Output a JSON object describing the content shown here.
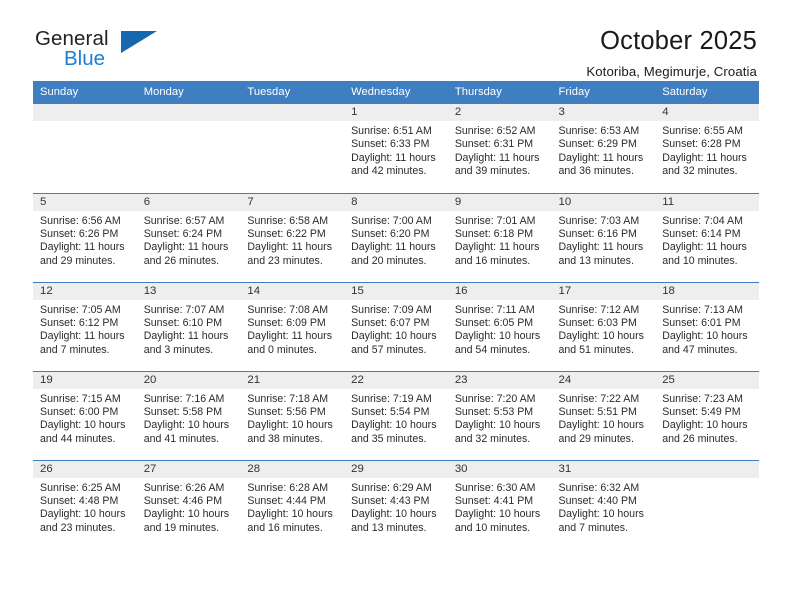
{
  "brand": {
    "name_top": "General",
    "name_bottom": "Blue",
    "triangle_icon": "triangle-logo-icon",
    "color_blue": "#1a7fd4",
    "color_triangle": "#1567b0"
  },
  "header": {
    "title": "October 2025",
    "subtitle": "Kotoriba, Megimurje, Croatia"
  },
  "calendar": {
    "header_bg": "#3f7fc1",
    "daynum_bg": "#eeeeee",
    "weekdays": [
      "Sunday",
      "Monday",
      "Tuesday",
      "Wednesday",
      "Thursday",
      "Friday",
      "Saturday"
    ],
    "weeks": [
      [
        {
          "day": "",
          "empty": true
        },
        {
          "day": "",
          "empty": true
        },
        {
          "day": "",
          "empty": true
        },
        {
          "day": "1",
          "sunrise": "Sunrise: 6:51 AM",
          "sunset": "Sunset: 6:33 PM",
          "daylight_line1": "Daylight: 11 hours",
          "daylight_line2": "and 42 minutes."
        },
        {
          "day": "2",
          "sunrise": "Sunrise: 6:52 AM",
          "sunset": "Sunset: 6:31 PM",
          "daylight_line1": "Daylight: 11 hours",
          "daylight_line2": "and 39 minutes."
        },
        {
          "day": "3",
          "sunrise": "Sunrise: 6:53 AM",
          "sunset": "Sunset: 6:29 PM",
          "daylight_line1": "Daylight: 11 hours",
          "daylight_line2": "and 36 minutes."
        },
        {
          "day": "4",
          "sunrise": "Sunrise: 6:55 AM",
          "sunset": "Sunset: 6:28 PM",
          "daylight_line1": "Daylight: 11 hours",
          "daylight_line2": "and 32 minutes."
        }
      ],
      [
        {
          "day": "5",
          "sunrise": "Sunrise: 6:56 AM",
          "sunset": "Sunset: 6:26 PM",
          "daylight_line1": "Daylight: 11 hours",
          "daylight_line2": "and 29 minutes."
        },
        {
          "day": "6",
          "sunrise": "Sunrise: 6:57 AM",
          "sunset": "Sunset: 6:24 PM",
          "daylight_line1": "Daylight: 11 hours",
          "daylight_line2": "and 26 minutes."
        },
        {
          "day": "7",
          "sunrise": "Sunrise: 6:58 AM",
          "sunset": "Sunset: 6:22 PM",
          "daylight_line1": "Daylight: 11 hours",
          "daylight_line2": "and 23 minutes."
        },
        {
          "day": "8",
          "sunrise": "Sunrise: 7:00 AM",
          "sunset": "Sunset: 6:20 PM",
          "daylight_line1": "Daylight: 11 hours",
          "daylight_line2": "and 20 minutes."
        },
        {
          "day": "9",
          "sunrise": "Sunrise: 7:01 AM",
          "sunset": "Sunset: 6:18 PM",
          "daylight_line1": "Daylight: 11 hours",
          "daylight_line2": "and 16 minutes."
        },
        {
          "day": "10",
          "sunrise": "Sunrise: 7:03 AM",
          "sunset": "Sunset: 6:16 PM",
          "daylight_line1": "Daylight: 11 hours",
          "daylight_line2": "and 13 minutes."
        },
        {
          "day": "11",
          "sunrise": "Sunrise: 7:04 AM",
          "sunset": "Sunset: 6:14 PM",
          "daylight_line1": "Daylight: 11 hours",
          "daylight_line2": "and 10 minutes."
        }
      ],
      [
        {
          "day": "12",
          "sunrise": "Sunrise: 7:05 AM",
          "sunset": "Sunset: 6:12 PM",
          "daylight_line1": "Daylight: 11 hours",
          "daylight_line2": "and 7 minutes."
        },
        {
          "day": "13",
          "sunrise": "Sunrise: 7:07 AM",
          "sunset": "Sunset: 6:10 PM",
          "daylight_line1": "Daylight: 11 hours",
          "daylight_line2": "and 3 minutes."
        },
        {
          "day": "14",
          "sunrise": "Sunrise: 7:08 AM",
          "sunset": "Sunset: 6:09 PM",
          "daylight_line1": "Daylight: 11 hours",
          "daylight_line2": "and 0 minutes."
        },
        {
          "day": "15",
          "sunrise": "Sunrise: 7:09 AM",
          "sunset": "Sunset: 6:07 PM",
          "daylight_line1": "Daylight: 10 hours",
          "daylight_line2": "and 57 minutes."
        },
        {
          "day": "16",
          "sunrise": "Sunrise: 7:11 AM",
          "sunset": "Sunset: 6:05 PM",
          "daylight_line1": "Daylight: 10 hours",
          "daylight_line2": "and 54 minutes."
        },
        {
          "day": "17",
          "sunrise": "Sunrise: 7:12 AM",
          "sunset": "Sunset: 6:03 PM",
          "daylight_line1": "Daylight: 10 hours",
          "daylight_line2": "and 51 minutes."
        },
        {
          "day": "18",
          "sunrise": "Sunrise: 7:13 AM",
          "sunset": "Sunset: 6:01 PM",
          "daylight_line1": "Daylight: 10 hours",
          "daylight_line2": "and 47 minutes."
        }
      ],
      [
        {
          "day": "19",
          "sunrise": "Sunrise: 7:15 AM",
          "sunset": "Sunset: 6:00 PM",
          "daylight_line1": "Daylight: 10 hours",
          "daylight_line2": "and 44 minutes."
        },
        {
          "day": "20",
          "sunrise": "Sunrise: 7:16 AM",
          "sunset": "Sunset: 5:58 PM",
          "daylight_line1": "Daylight: 10 hours",
          "daylight_line2": "and 41 minutes."
        },
        {
          "day": "21",
          "sunrise": "Sunrise: 7:18 AM",
          "sunset": "Sunset: 5:56 PM",
          "daylight_line1": "Daylight: 10 hours",
          "daylight_line2": "and 38 minutes."
        },
        {
          "day": "22",
          "sunrise": "Sunrise: 7:19 AM",
          "sunset": "Sunset: 5:54 PM",
          "daylight_line1": "Daylight: 10 hours",
          "daylight_line2": "and 35 minutes."
        },
        {
          "day": "23",
          "sunrise": "Sunrise: 7:20 AM",
          "sunset": "Sunset: 5:53 PM",
          "daylight_line1": "Daylight: 10 hours",
          "daylight_line2": "and 32 minutes."
        },
        {
          "day": "24",
          "sunrise": "Sunrise: 7:22 AM",
          "sunset": "Sunset: 5:51 PM",
          "daylight_line1": "Daylight: 10 hours",
          "daylight_line2": "and 29 minutes."
        },
        {
          "day": "25",
          "sunrise": "Sunrise: 7:23 AM",
          "sunset": "Sunset: 5:49 PM",
          "daylight_line1": "Daylight: 10 hours",
          "daylight_line2": "and 26 minutes."
        }
      ],
      [
        {
          "day": "26",
          "sunrise": "Sunrise: 6:25 AM",
          "sunset": "Sunset: 4:48 PM",
          "daylight_line1": "Daylight: 10 hours",
          "daylight_line2": "and 23 minutes."
        },
        {
          "day": "27",
          "sunrise": "Sunrise: 6:26 AM",
          "sunset": "Sunset: 4:46 PM",
          "daylight_line1": "Daylight: 10 hours",
          "daylight_line2": "and 19 minutes."
        },
        {
          "day": "28",
          "sunrise": "Sunrise: 6:28 AM",
          "sunset": "Sunset: 4:44 PM",
          "daylight_line1": "Daylight: 10 hours",
          "daylight_line2": "and 16 minutes."
        },
        {
          "day": "29",
          "sunrise": "Sunrise: 6:29 AM",
          "sunset": "Sunset: 4:43 PM",
          "daylight_line1": "Daylight: 10 hours",
          "daylight_line2": "and 13 minutes."
        },
        {
          "day": "30",
          "sunrise": "Sunrise: 6:30 AM",
          "sunset": "Sunset: 4:41 PM",
          "daylight_line1": "Daylight: 10 hours",
          "daylight_line2": "and 10 minutes."
        },
        {
          "day": "31",
          "sunrise": "Sunrise: 6:32 AM",
          "sunset": "Sunset: 4:40 PM",
          "daylight_line1": "Daylight: 10 hours",
          "daylight_line2": "and 7 minutes."
        },
        {
          "day": "",
          "empty": true
        }
      ]
    ]
  }
}
